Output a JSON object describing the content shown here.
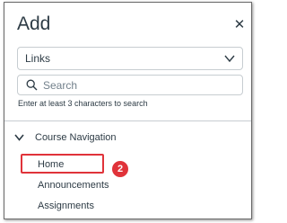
{
  "dialog": {
    "title": "Add",
    "close_icon": "close-icon"
  },
  "type_select": {
    "value": "Links",
    "icon": "chevron-down-icon"
  },
  "search": {
    "placeholder": "Search",
    "value": "",
    "icon": "search-icon",
    "hint": "Enter at least 3 characters to search"
  },
  "section": {
    "label": "Course Navigation",
    "icon": "chevron-down-icon",
    "items": [
      "Home",
      "Announcements",
      "Assignments"
    ]
  },
  "annotation": {
    "callout_number": "2",
    "color": "#e0333a"
  },
  "colors": {
    "text": "#2d3b45",
    "border": "#c7cdd1",
    "placeholder": "#73818c"
  }
}
